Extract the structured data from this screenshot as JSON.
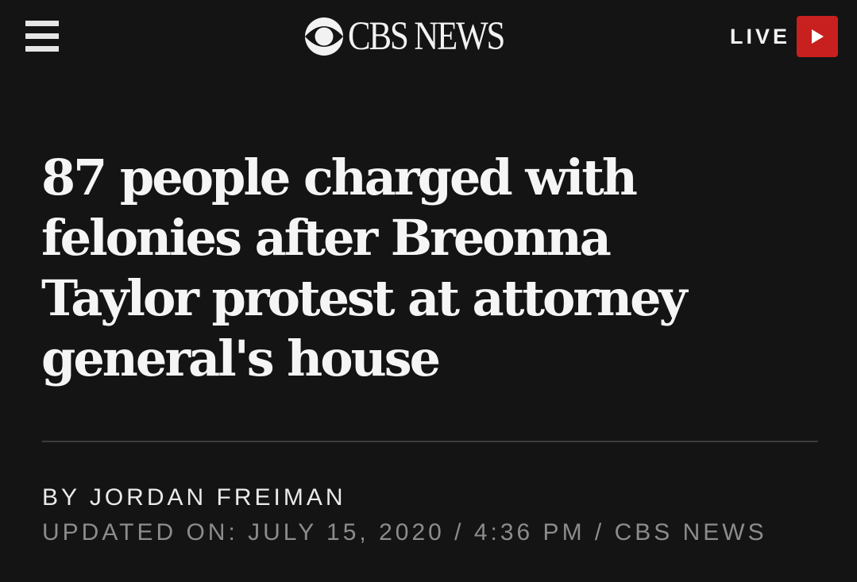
{
  "header": {
    "logo_text": "CBS NEWS",
    "live_label": "LIVE",
    "menu_icon": "hamburger-menu-icon",
    "logo_icon": "cbs-eye-icon",
    "play_icon": "play-icon",
    "live_button_color": "#c8201e"
  },
  "article": {
    "headline": "87 people charged with felonies after Breonna Taylor protest at attorney general's house",
    "byline": "BY JORDAN FREIMAN",
    "updated": "UPDATED ON: JULY 15, 2020 / 4:36 PM / CBS NEWS"
  },
  "colors": {
    "background": "#141414",
    "text": "#f5f5f5",
    "meta_text": "#8c8c8c"
  }
}
